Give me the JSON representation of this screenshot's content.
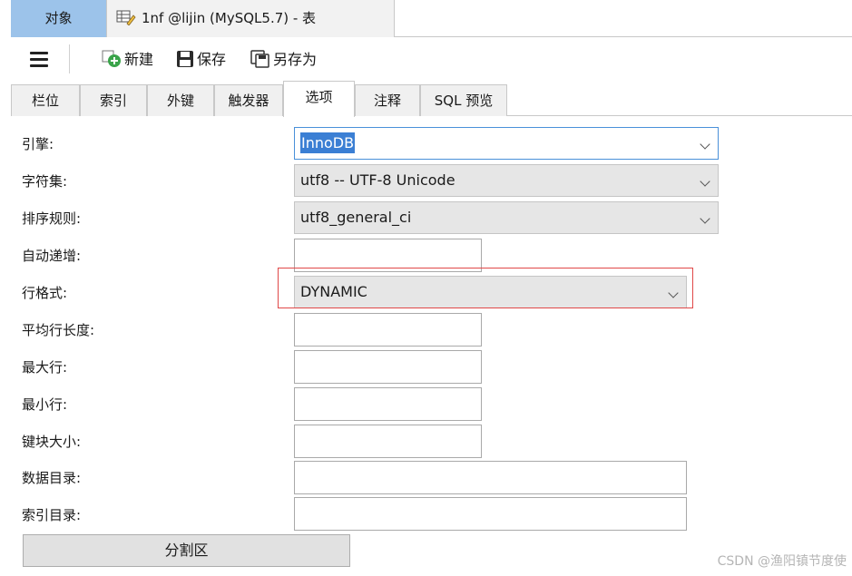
{
  "window_tabs": {
    "objects_label": "对象",
    "table_tab_icon": "table-edit-icon",
    "table_tab_label": "1nf @lijin (MySQL5.7) - 表"
  },
  "toolbar": {
    "menu_icon": "hamburger-icon",
    "new_label": "新建",
    "save_label": "保存",
    "save_as_label": "另存为"
  },
  "subtabs": {
    "fields": "栏位",
    "indexes": "索引",
    "foreign_keys": "外键",
    "triggers": "触发器",
    "options": "选项",
    "comment": "注释",
    "sql_preview": "SQL 预览",
    "active": "选项"
  },
  "form": {
    "engine_label": "引擎:",
    "engine_value": "InnoDB",
    "charset_label": "字符集:",
    "charset_value": "utf8 -- UTF-8 Unicode",
    "collation_label": "排序规则:",
    "collation_value": "utf8_general_ci",
    "auto_increment_label": "自动递增:",
    "row_format_label": "行格式:",
    "row_format_value": "DYNAMIC",
    "avg_row_length_label": "平均行长度:",
    "max_rows_label": "最大行:",
    "min_rows_label": "最小行:",
    "key_block_size_label": "键块大小:",
    "data_directory_label": "数据目录:",
    "index_directory_label": "索引目录:",
    "partition_button": "分割区"
  },
  "watermark": "CSDN @渔阳镇节度使",
  "colors": {
    "objects_tab_bg": "#9cc3ea",
    "highlight_border": "#e04848",
    "selection_bg": "#3b7fd4"
  }
}
